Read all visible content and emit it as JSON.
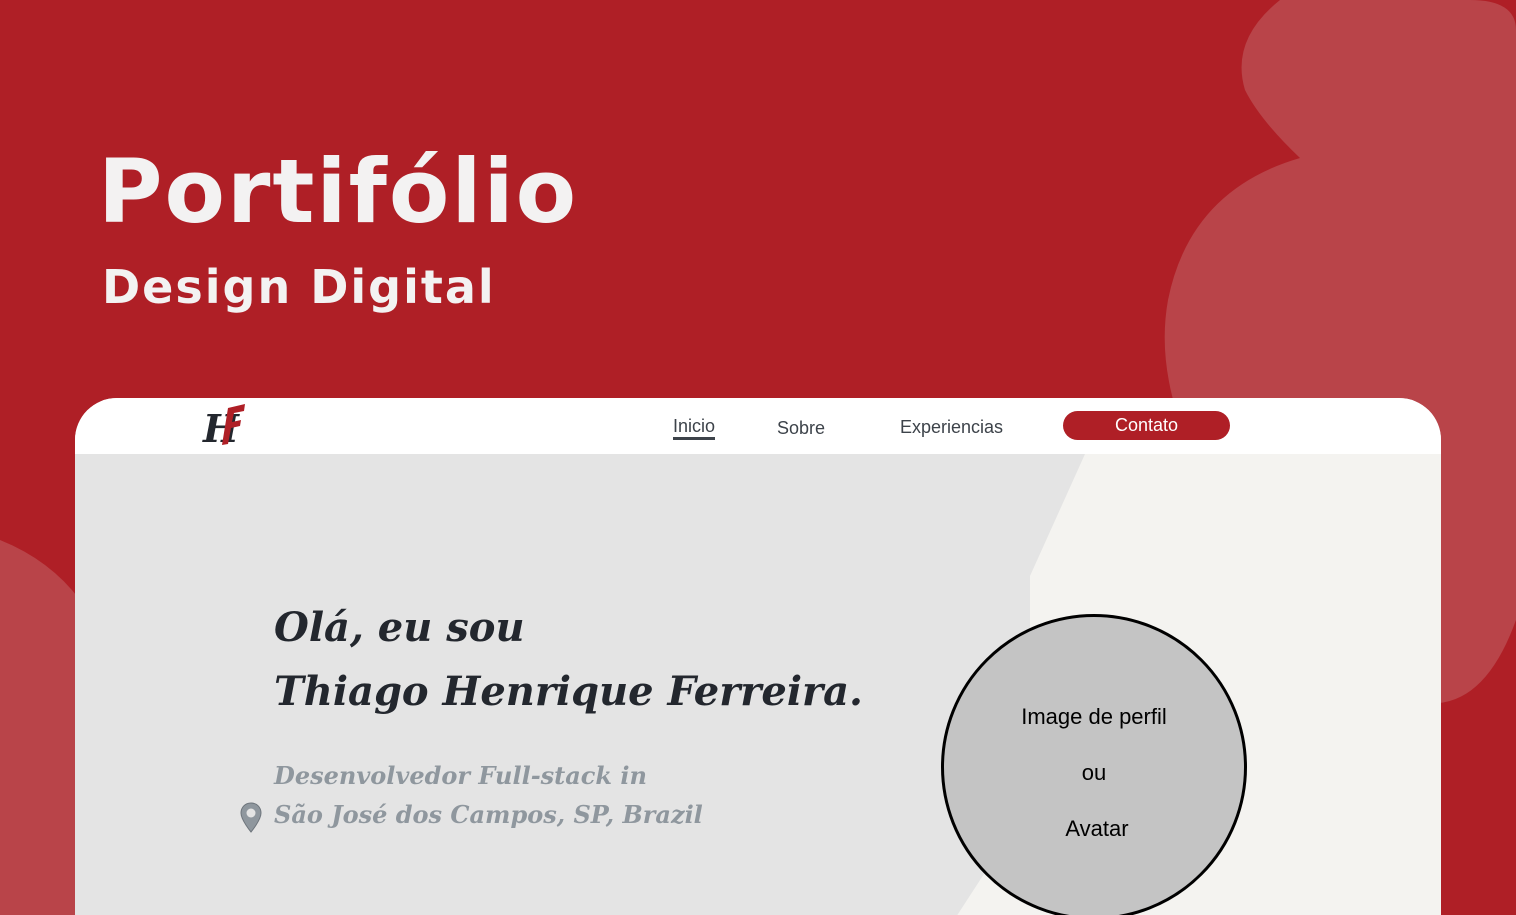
{
  "hero": {
    "title": "Portifólio",
    "subtitle": "Design Digital"
  },
  "navbar": {
    "logo_icon": "hf-monogram-logo",
    "links": [
      {
        "label": "Inicio",
        "active": true
      },
      {
        "label": "Sobre",
        "active": false
      },
      {
        "label": "Experiencias",
        "active": false
      }
    ],
    "cta_label": "Contato"
  },
  "intro": {
    "greeting_line1": "Olá, eu sou",
    "greeting_line2": "Thiago Henrique Ferreira.",
    "role_line1": "Desenvolvedor Full-stack in",
    "role_line2": "São José dos Campos, SP, Brazil",
    "location_icon": "map-pin-icon"
  },
  "avatar": {
    "line1": "Image de perfil",
    "line2": "ou",
    "line3": "Avatar"
  },
  "colors": {
    "brand_red": "#AF1F26",
    "blob_red": "#B94449",
    "panel_gray": "#E4E4E4",
    "panel_offwhite": "#F4F3F0",
    "avatar_gray": "#C4C4C4",
    "text_dark": "#23272E",
    "text_muted": "#8F979E",
    "title_white": "#F3F2F2"
  }
}
